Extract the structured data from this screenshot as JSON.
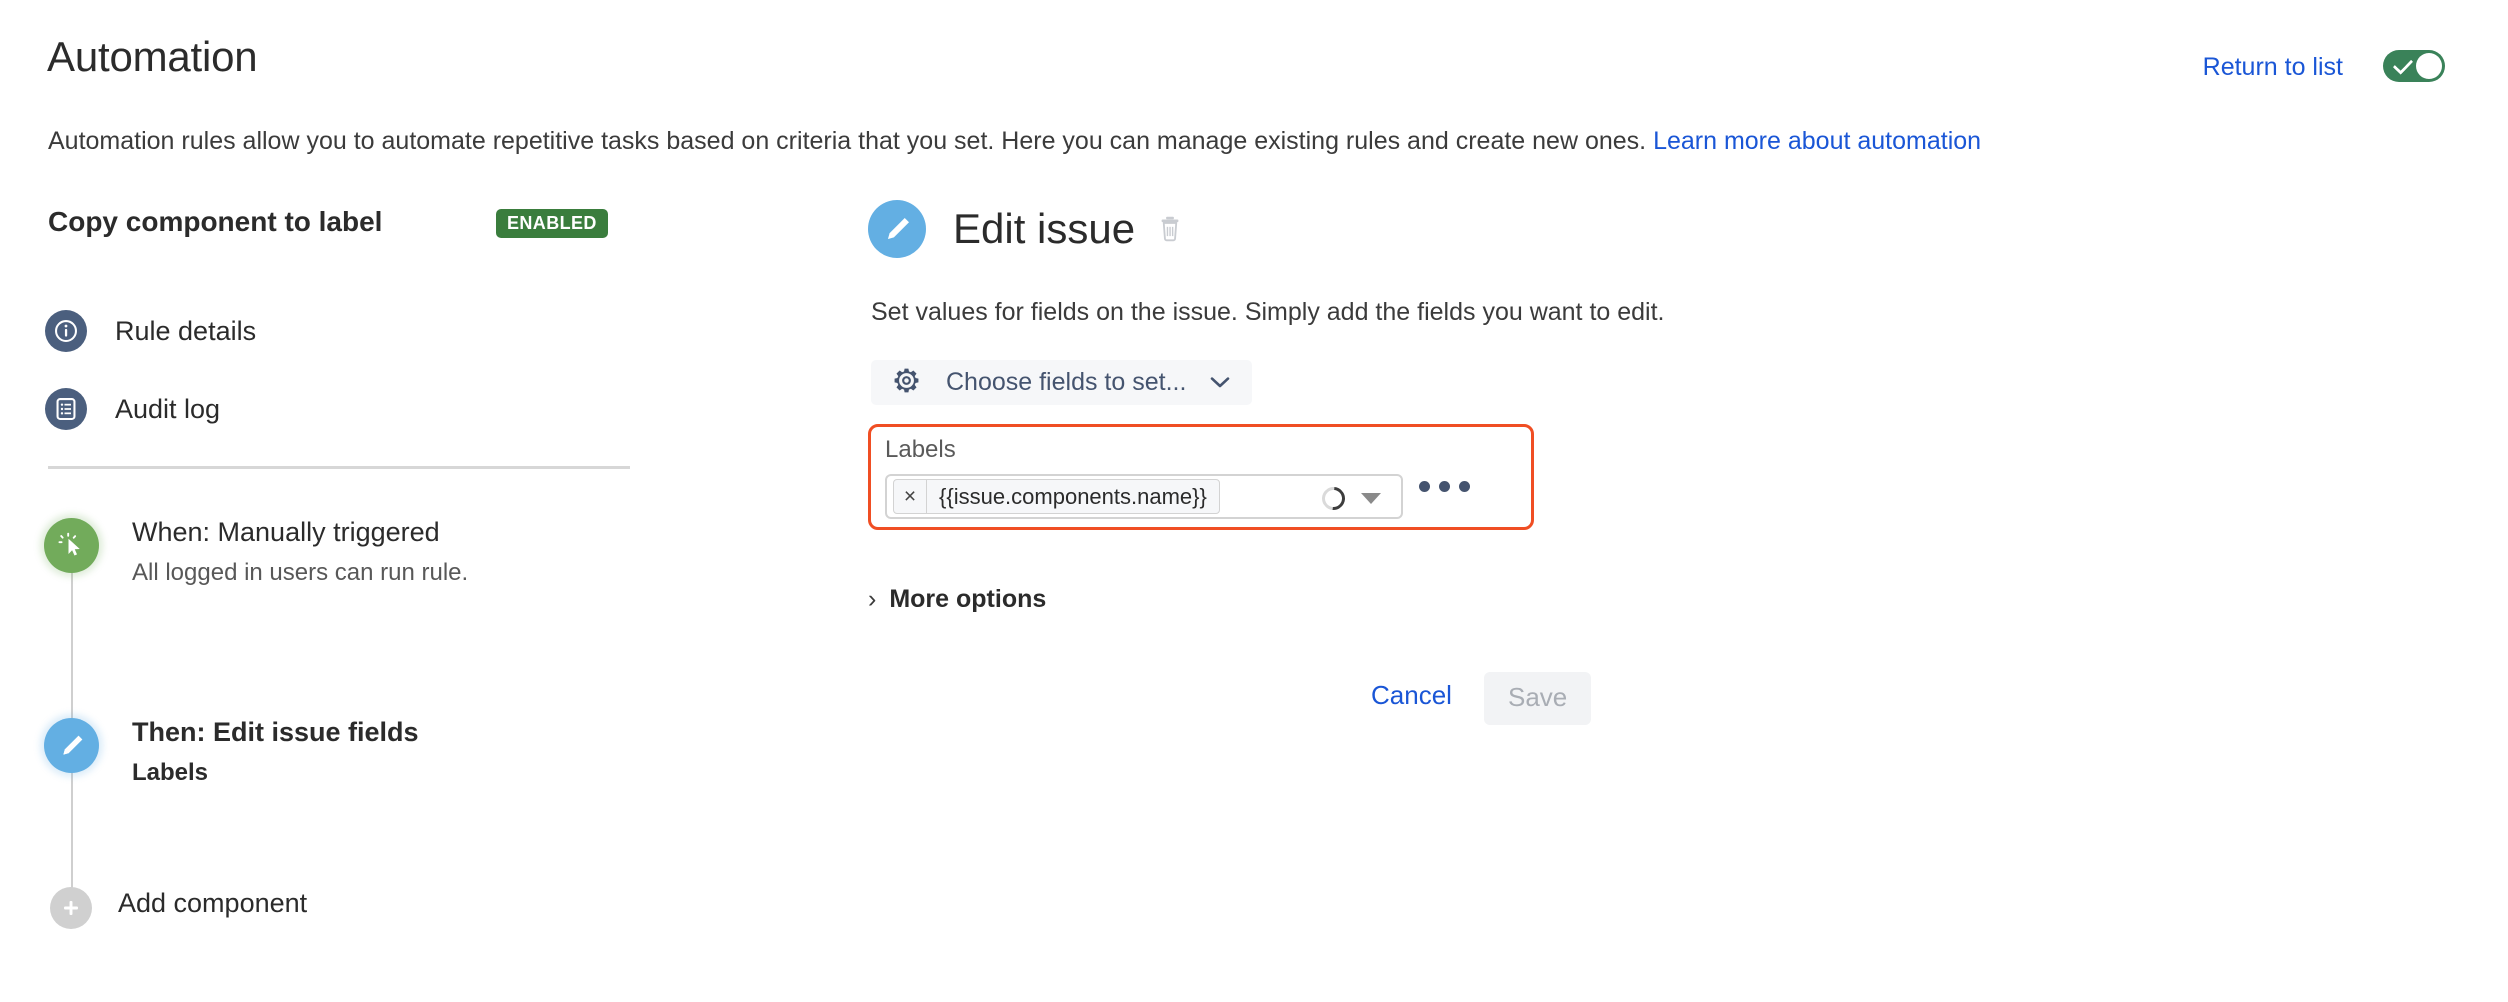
{
  "header": {
    "title": "Automation",
    "description_prefix": "Automation rules allow you to automate repetitive tasks based on criteria that you set. Here you can manage existing rules and create new ones. ",
    "description_link": "Learn more about automation",
    "return_link": "Return to list",
    "toggle": {
      "name": "rule-enabled-toggle",
      "state": "on",
      "color": "#3a8259"
    }
  },
  "sidebar": {
    "rule_name": "Copy component to label",
    "status_badge": {
      "text": "ENABLED",
      "color": "#3a7d3d"
    },
    "nav": [
      {
        "label": "Rule details",
        "icon": "info-icon"
      },
      {
        "label": "Audit log",
        "icon": "list-document-icon"
      }
    ],
    "timeline": [
      {
        "title": "When: Manually triggered",
        "subtitle": "All logged in users can run rule.",
        "icon": "cursor-click-icon",
        "color": "#72ab5b"
      },
      {
        "title": "Then: Edit issue fields",
        "subtitle": "Labels",
        "icon": "pencil-icon",
        "color": "#63afe3"
      },
      {
        "title": "Add component",
        "subtitle": "",
        "icon": "plus-icon",
        "color": "#d0d0d0"
      }
    ]
  },
  "panel": {
    "title": "Edit issue",
    "avatar_icon": "pencil-icon",
    "delete_icon": "trash-icon",
    "description": "Set values for fields on the issue. Simply add the fields you want to edit.",
    "choose_fields": {
      "label": "Choose fields to set...",
      "icon": "gear-icon",
      "caret": "chevron-down-icon"
    },
    "labels_field": {
      "label": "Labels",
      "chip_remove": "×",
      "chip_value": "{{issue.components.name}}",
      "loading": true,
      "more_menu": "ellipsis-icon",
      "highlight_color": "#f04e23"
    },
    "more_options": {
      "label": "More options",
      "chevron": "›"
    },
    "footer": {
      "cancel_label": "Cancel",
      "save_label": "Save",
      "save_disabled": true
    }
  }
}
